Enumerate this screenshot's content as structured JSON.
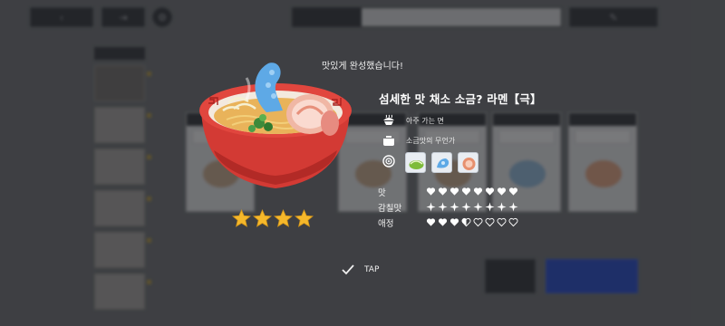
{
  "background": {
    "top_buttons": [
      {
        "icon": "back-arrow-icon",
        "glyph": "‹"
      },
      {
        "icon": "skip-icon",
        "glyph": "⇥"
      },
      {
        "icon": "settings-icon",
        "glyph": "⚙"
      }
    ],
    "top_center": {
      "tab_label": "",
      "field_text": ""
    },
    "top_right_icon": "pencil-icon",
    "side_list_header": "",
    "card_count": 5
  },
  "result": {
    "complete_message": "맛있게 완성했습니다!",
    "dish_name": "섬세한 맛 채소 소금? 라멘【극】",
    "traits": [
      {
        "icon": "noodle-icon",
        "text": "아주 가는 면"
      },
      {
        "icon": "pot-icon",
        "text": "소금맛의 무언가"
      }
    ],
    "ingredients": [
      {
        "icon": "vegetable-ingredient-icon",
        "color": "#7dbb3a"
      },
      {
        "icon": "seaweed-ingredient-icon",
        "color": "#5ea9e6"
      },
      {
        "icon": "chashu-ingredient-icon",
        "color": "#e7906e"
      }
    ],
    "stats": [
      {
        "label": "맛",
        "shape": "heart",
        "filled": 8,
        "half": 0,
        "total": 8
      },
      {
        "label": "감칠맛",
        "shape": "sparkle",
        "filled": 8,
        "half": 0,
        "total": 8
      },
      {
        "label": "애정",
        "shape": "heart",
        "filled": 3,
        "half": 1,
        "total": 8
      }
    ],
    "rating": {
      "stars": 4,
      "max": 4,
      "color": "#f5b82b"
    },
    "tap_label": "TAP"
  },
  "colors": {
    "bowl_red": "#d33a34",
    "broth": "#e9b35a",
    "blue_accent": "#2145c9"
  }
}
